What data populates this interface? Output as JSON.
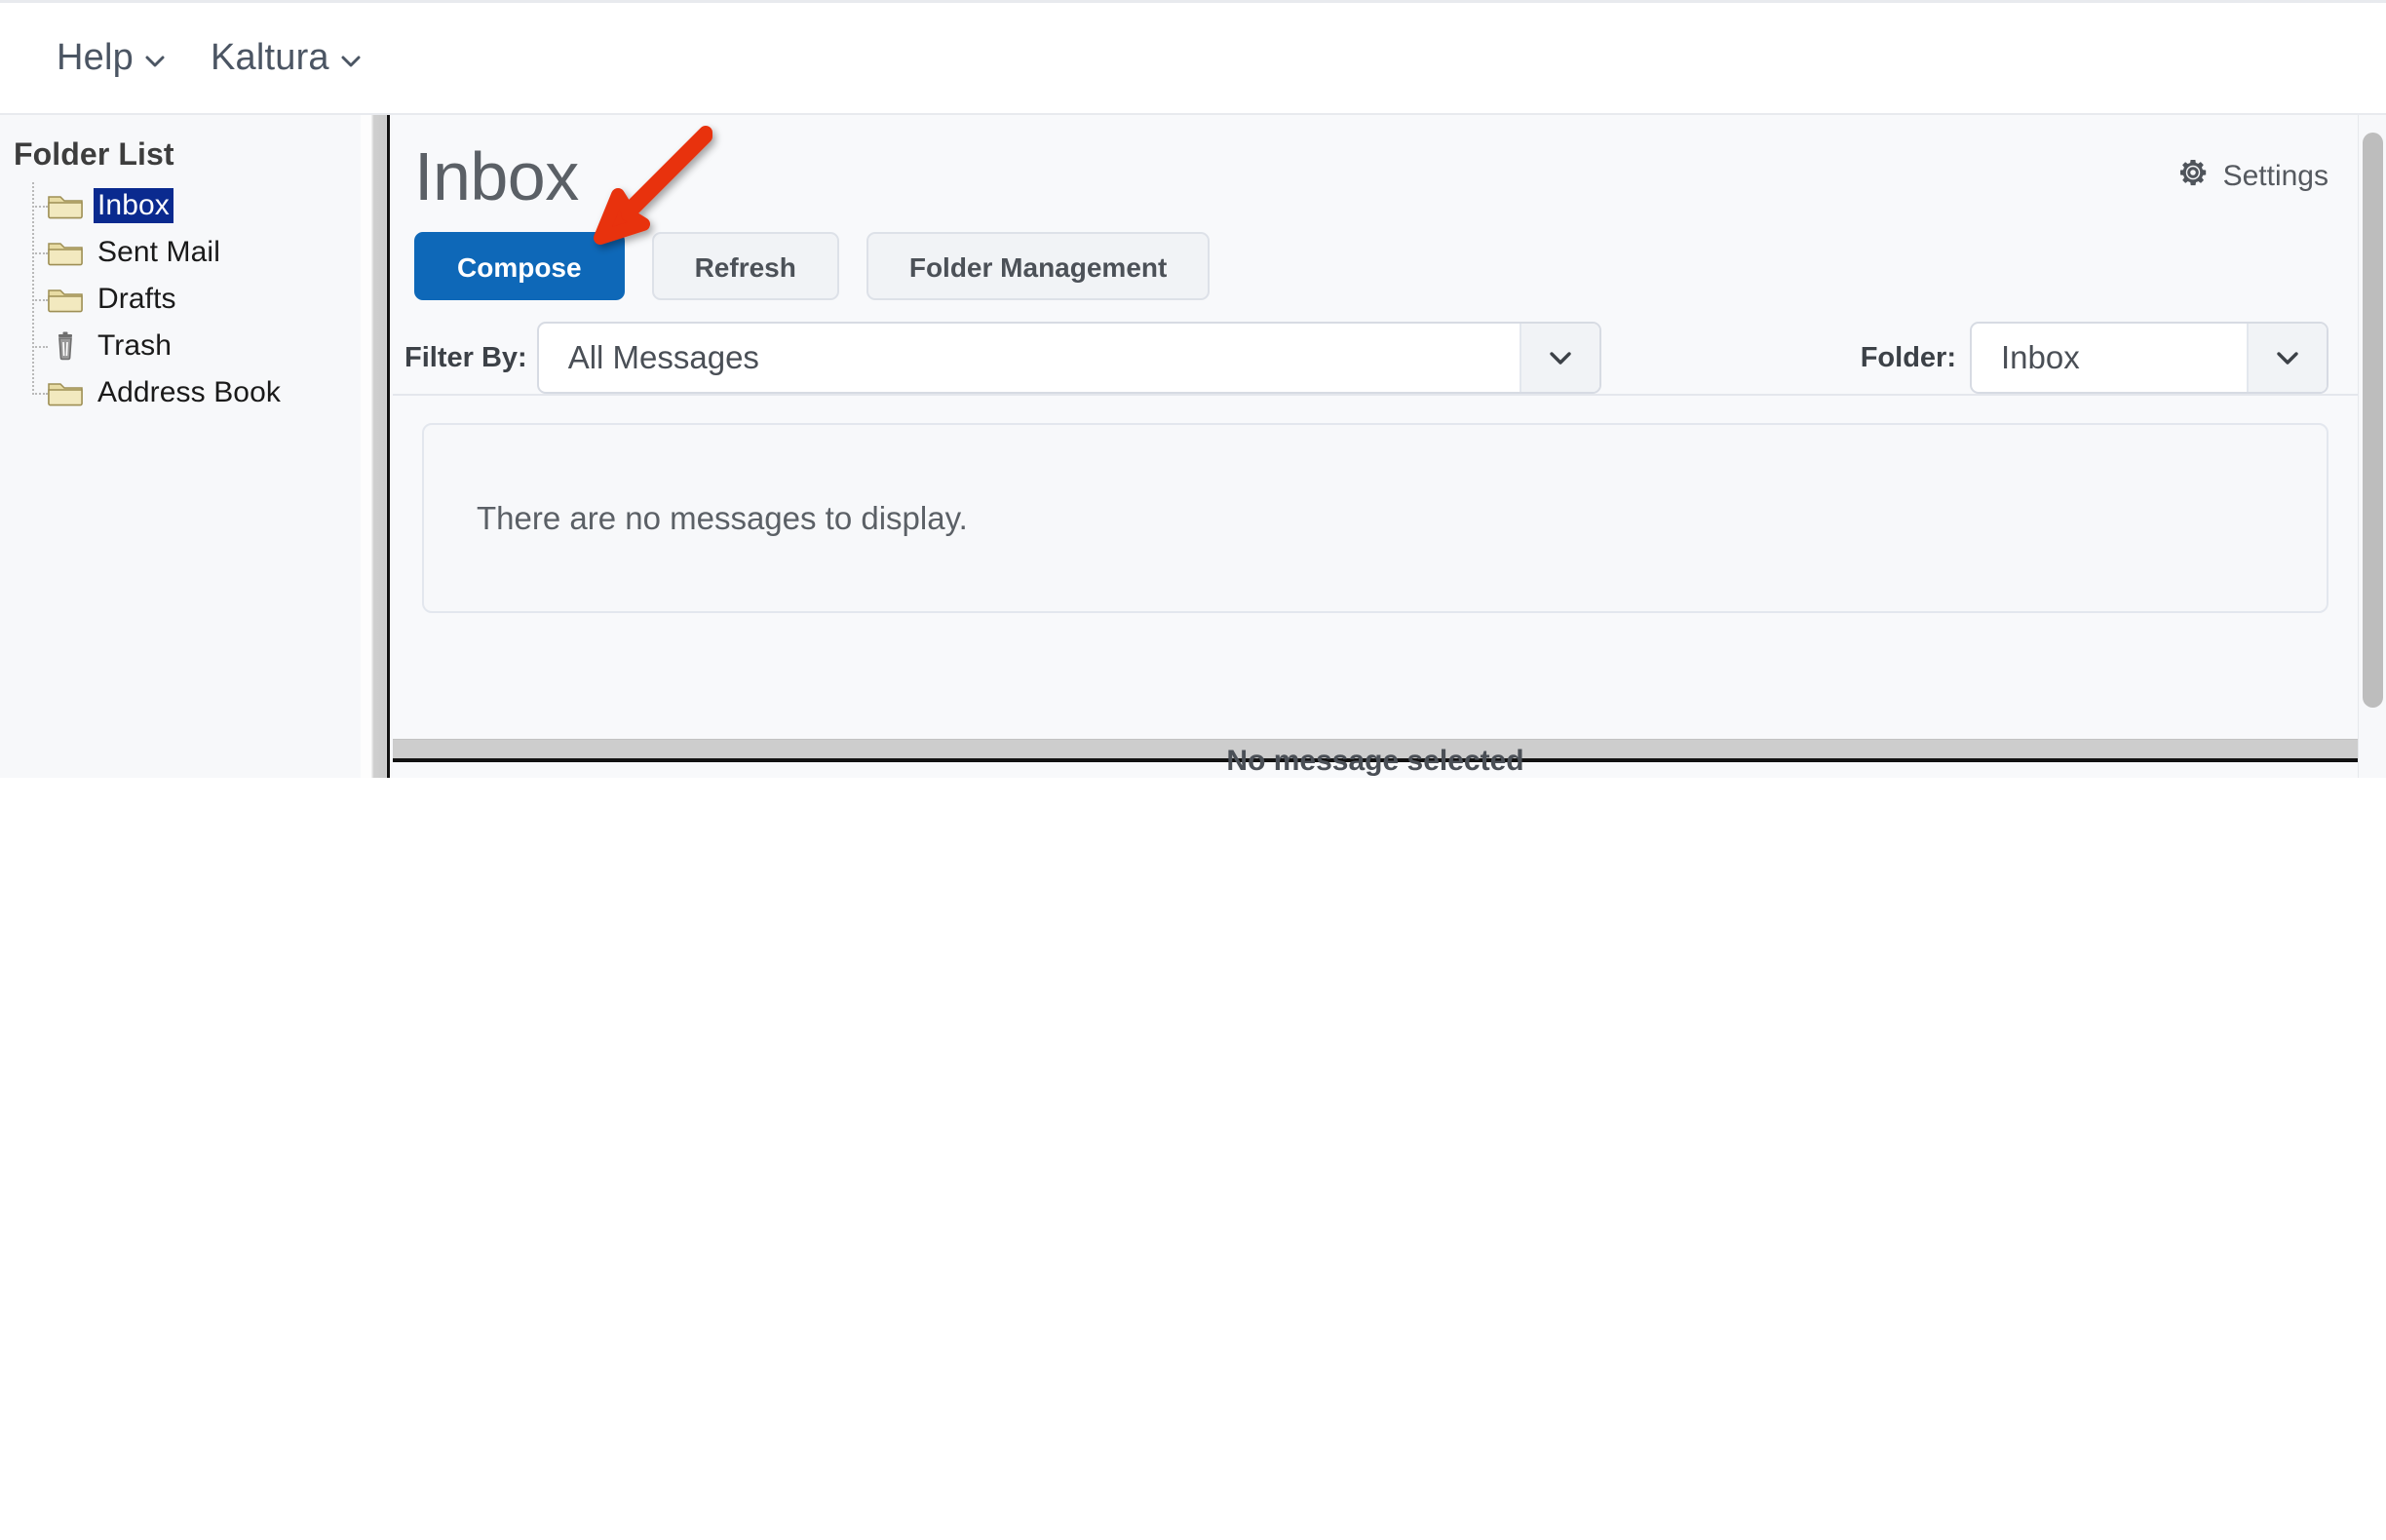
{
  "topnav": {
    "items": [
      {
        "label": "Help",
        "icon": "chevron-down-icon"
      },
      {
        "label": "Kaltura",
        "icon": "chevron-down-icon"
      }
    ]
  },
  "sidebar": {
    "title": "Folder List",
    "items": [
      {
        "label": "Inbox",
        "icon": "folder-icon",
        "selected": true
      },
      {
        "label": "Sent Mail",
        "icon": "folder-icon",
        "selected": false
      },
      {
        "label": "Drafts",
        "icon": "folder-icon",
        "selected": false
      },
      {
        "label": "Trash",
        "icon": "trash-icon",
        "selected": false
      },
      {
        "label": "Address Book",
        "icon": "folder-icon",
        "selected": false
      }
    ],
    "selection_color": "#0a2a8f"
  },
  "main": {
    "page_title": "Inbox",
    "settings": {
      "label": "Settings",
      "icon": "gear-icon"
    },
    "buttons": [
      {
        "label": "Compose",
        "style": "primary"
      },
      {
        "label": "Refresh",
        "style": "secondary"
      },
      {
        "label": "Folder Management",
        "style": "secondary"
      }
    ],
    "primary_color": "#0e68b8",
    "filter": {
      "label": "Filter By:",
      "value": "All Messages",
      "icon": "chevron-down-icon"
    },
    "folder": {
      "label": "Folder:",
      "value": "Inbox",
      "icon": "chevron-down-icon"
    },
    "message_list": {
      "empty_text": "There are no messages to display."
    },
    "detail": {
      "empty_text": "No message selected"
    }
  },
  "annotation": {
    "arrow_color": "#e8300c",
    "name": "red-pointer-arrow"
  }
}
